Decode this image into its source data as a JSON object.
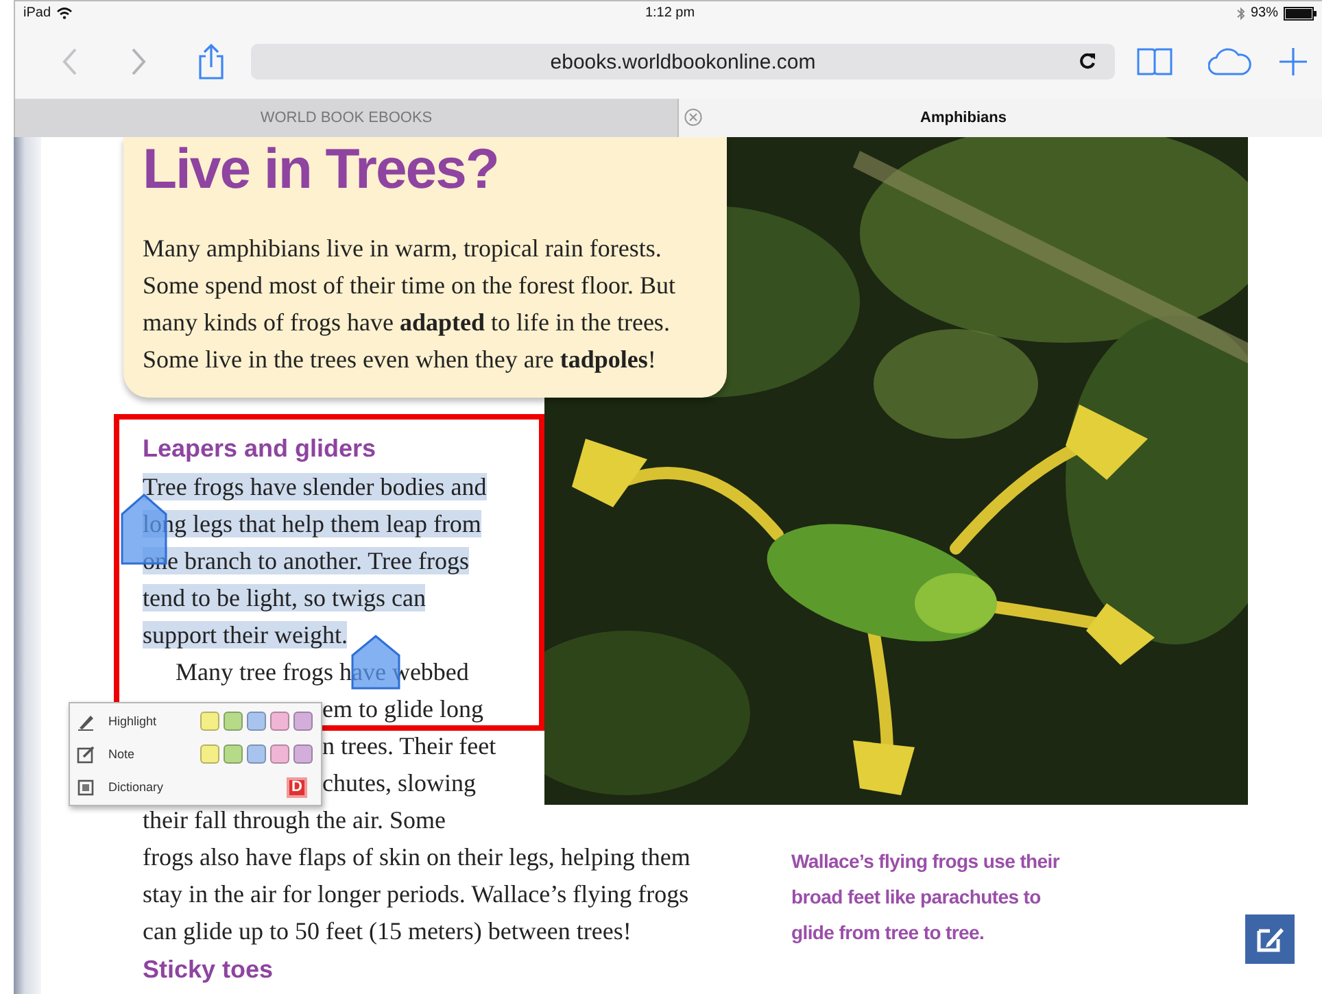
{
  "status_bar": {
    "device": "iPad",
    "time": "1:12 pm",
    "battery": "93%"
  },
  "toolbar": {
    "url": "ebooks.worldbookonline.com"
  },
  "tabs": [
    {
      "label": "WORLD BOOK EBOOKS",
      "selected": false
    },
    {
      "label": "Amphibians",
      "selected": true
    }
  ],
  "page": {
    "intro": {
      "title": "Live in Trees?",
      "lines": [
        "Many amphibians live in warm, tropical rain forests.",
        "Some spend most of their time on the forest floor. But",
        "many kinds of frogs have **adapted** to life in the trees.",
        "Some live in the trees even when they are **tadpoles**!"
      ]
    },
    "heading": "Leapers and gliders",
    "paragraphs": [
      {
        "selected": true,
        "lines": [
          "Tree frogs have slender bodies and",
          "long legs that help them leap from",
          "one branch to another. Tree frogs",
          "tend to be light, so twigs can",
          "support their weight."
        ]
      },
      {
        "selected": false,
        "lines": [
          {
            "kind": "indent",
            "text": "Many tree frogs have webbed"
          },
          {
            "kind": "covered",
            "text": "em to glide long"
          },
          {
            "kind": "covered",
            "text": "n trees. Their feet"
          },
          {
            "kind": "covered",
            "text": "chutes, slowing"
          },
          {
            "kind": "plain",
            "text": "their fall through the air. Some"
          },
          {
            "kind": "plain",
            "text": "frogs also have flaps of skin on their legs, helping them"
          },
          {
            "kind": "plain",
            "text": "stay in the air for longer periods. Wallace’s flying frogs"
          },
          {
            "kind": "plain",
            "text": "can glide up to 50 feet (15 meters) between trees!"
          }
        ]
      }
    ],
    "caption": [
      "Wallace’s flying frogs use their",
      "broad feet like parachutes to",
      "glide from tree to tree."
    ],
    "next_heading": "Sticky toes"
  },
  "popup": {
    "items": [
      {
        "kind": "colors",
        "label": "Highlight",
        "swatches": [
          {
            "color": "#f4ee86"
          },
          {
            "color": "#b5da88"
          },
          {
            "color": "#a8c4ee"
          },
          {
            "color": "#f0b4d4"
          },
          {
            "color": "#d4aedb"
          }
        ]
      },
      {
        "kind": "colors",
        "label": "Note",
        "swatches": [
          {
            "color": "#f4ee86"
          },
          {
            "color": "#b5da88"
          },
          {
            "color": "#a8c4ee"
          },
          {
            "color": "#f0b4d4"
          },
          {
            "color": "#d4aedb"
          }
        ]
      },
      {
        "kind": "dictionary",
        "label": "Dictionary",
        "badge": "D"
      }
    ]
  }
}
